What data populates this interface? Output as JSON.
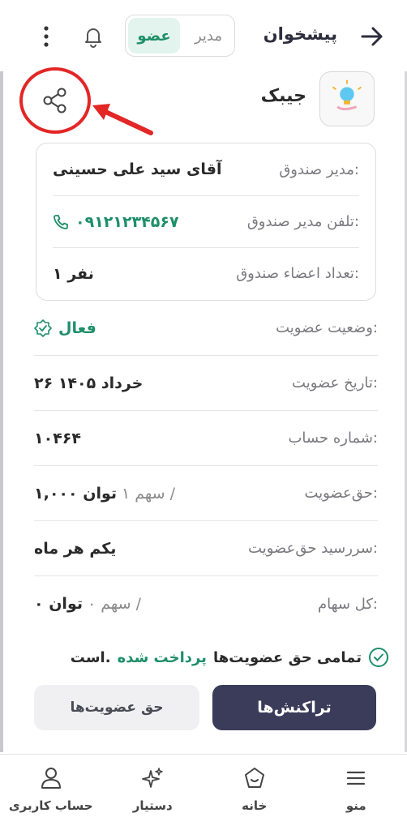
{
  "header": {
    "title": "پیشخوان",
    "role_toggle": {
      "manager_label": "مدیر",
      "member_label": "عضو",
      "active": "member"
    },
    "back_icon": "arrow-right-icon",
    "bell_icon": "bell-icon",
    "menu_icon": "kebab-icon"
  },
  "fund": {
    "name": "جیبک",
    "logo_icon": "lightbulb-logo-icon",
    "share_icon": "share-icon"
  },
  "fund_card": {
    "manager_label": "مدیر صندوق:",
    "manager_value": "آقای سید علی حسینی",
    "phone_label": "تلفن مدیر صندوق:",
    "phone_value": "۰۹۱۲۱۲۳۴۵۶۷",
    "members_label": "تعداد اعضاء صندوق:",
    "members_value": "۱ نفر"
  },
  "membership": {
    "status_label": "وضعیت عضویت:",
    "status_value": "فعال",
    "date_label": "تاریخ عضویت:",
    "date_value": "۲۶ خرداد ۱۴۰۵",
    "account_label": "شماره حساب:",
    "account_value": "۱۰۴۶۴",
    "fee_label": "حق‌عضویت:",
    "fee_shares": "۱ سهم /",
    "fee_amount": "۱,۰۰۰ توان",
    "due_label": "سررسید حق‌عضویت:",
    "due_value": "یکم هر ماه",
    "shares_label": "کل سهام:",
    "shares_count": "۰ سهم /",
    "shares_amount": "۰ توان"
  },
  "notice": {
    "part1": "تمامی حق عضویت‌ها",
    "part2": "پرداخت شده",
    "part3": "است."
  },
  "actions": {
    "transactions_label": "تراکنش‌ها",
    "fees_label": "حق عضویت‌ها"
  },
  "bottom_nav": {
    "menu": "منو",
    "home": "خانه",
    "assistant": "دستیار",
    "account": "حساب کاربری"
  },
  "colors": {
    "accent_green": "#1f8f68",
    "primary_button": "#3a3c5a",
    "annotation_red": "#e32626"
  }
}
